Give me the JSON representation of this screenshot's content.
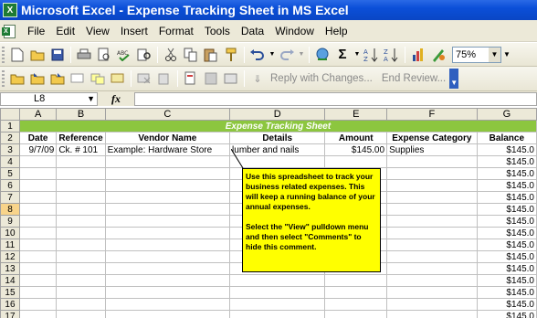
{
  "window": {
    "title": "Microsoft Excel - Expense Tracking Sheet in MS Excel"
  },
  "menu": [
    "File",
    "Edit",
    "View",
    "Insert",
    "Format",
    "Tools",
    "Data",
    "Window",
    "Help"
  ],
  "toolbar": {
    "zoom": "75%"
  },
  "reviewing": {
    "reply_label": "Reply with Changes...",
    "end_label": "End Review..."
  },
  "formula_bar": {
    "name_box": "L8",
    "fx": "fx"
  },
  "columns": [
    "A",
    "B",
    "C",
    "D",
    "E",
    "F",
    "G"
  ],
  "sheet": {
    "banner": "Expense Tracking Sheet",
    "headers": [
      "Date",
      "Reference",
      "Vendor Name",
      "Details",
      "Amount",
      "Expense Category",
      "Balance"
    ],
    "first_row": [
      "9/7/09",
      "Ck. # 101",
      "Example: Hardware Store",
      "lumber and nails",
      "$145.00",
      "Supplies",
      "$145.0"
    ],
    "balance_value": "$145.0",
    "row_numbers": [
      "1",
      "2",
      "3",
      "4",
      "5",
      "6",
      "7",
      "8",
      "9",
      "10",
      "11",
      "12",
      "13",
      "14",
      "15",
      "16",
      "17"
    ],
    "selected_row": "8"
  },
  "comment": {
    "para1": "Use this spreadsheet to track your business related expenses. This will keep a running balance of your annual expenses.",
    "para2": "Select the \"View\" pulldown menu and then select \"Comments\" to hide this comment."
  },
  "colors": {
    "banner": "#8cc63f",
    "comment": "#ffff00",
    "titlebar": "#0b4fd8"
  }
}
